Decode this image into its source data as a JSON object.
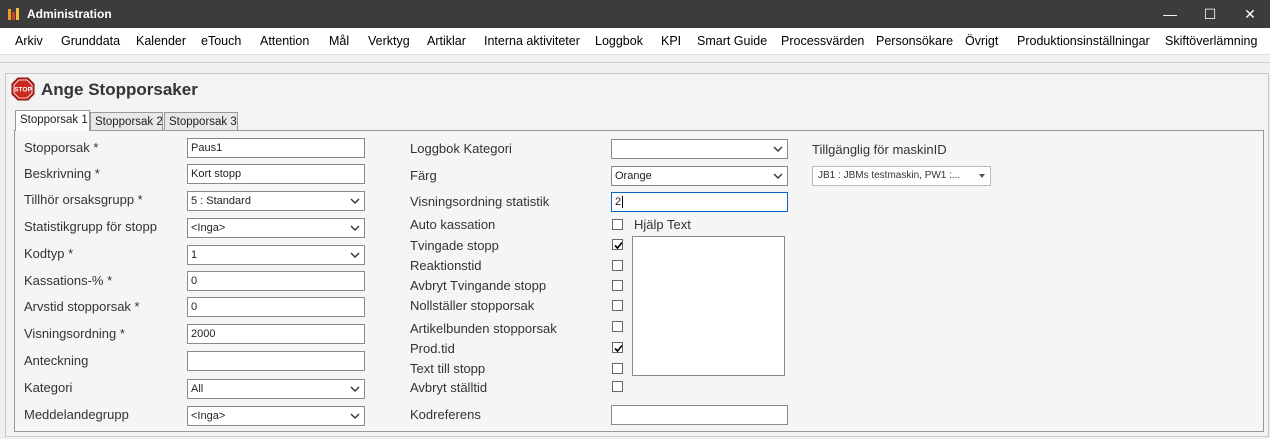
{
  "window": {
    "title": "Administration",
    "minimize": "—",
    "maximize": "☐",
    "close": "✕"
  },
  "menu": [
    "Arkiv",
    "Grunddata",
    "Kalender",
    "eTouch",
    "Attention",
    "Mål",
    "Verktyg",
    "Artiklar",
    "Interna aktiviteter",
    "Loggbok",
    "KPI",
    "Smart Guide",
    "Processvärden",
    "Personsökare",
    "Övrigt",
    "Produktionsinställningar",
    "Skiftöverlämning"
  ],
  "page": {
    "title": "Ange Stopporsaker",
    "stop_icon_text": "STOP"
  },
  "tabs": [
    "Stopporsak 1",
    "Stopporsak 2",
    "Stopporsak 3"
  ],
  "left": {
    "stopporsak": {
      "label": "Stopporsak *",
      "value": "Paus1"
    },
    "beskrivning": {
      "label": "Beskrivning *",
      "value": "Kort stopp"
    },
    "orsaksgrupp": {
      "label": "Tillhör orsaksgrupp *",
      "value": "5 : Standard"
    },
    "statistikgrupp": {
      "label": "Statistikgrupp för stopp",
      "value": "<Inga>"
    },
    "kodtyp": {
      "label": "Kodtyp *",
      "value": "1"
    },
    "kassation": {
      "label": "Kassations-% *",
      "value": "0"
    },
    "arvstid": {
      "label": "Arvstid stopporsak *",
      "value": "0"
    },
    "visningsordning": {
      "label": "Visningsordning *",
      "value": "2000"
    },
    "anteckning": {
      "label": "Anteckning",
      "value": ""
    },
    "kategori": {
      "label": "Kategori",
      "value": "All"
    },
    "meddelandegrupp": {
      "label": "Meddelandegrupp",
      "value": "<Inga>"
    }
  },
  "middle": {
    "loggbok_kategori": {
      "label": "Loggbok Kategori",
      "value": ""
    },
    "farg": {
      "label": "Färg",
      "value": "Orange"
    },
    "visning_statistik": {
      "label": "Visningsordning statistik",
      "value": "2"
    },
    "checks": [
      {
        "label": "Auto kassation",
        "checked": false
      },
      {
        "label": "Tvingade stopp",
        "checked": true
      },
      {
        "label": "Reaktionstid",
        "checked": false
      },
      {
        "label": "Avbryt Tvingande stopp",
        "checked": false
      },
      {
        "label": "Nollställer stopporsak",
        "checked": false
      },
      {
        "label": "Artikelbunden stopporsak",
        "checked": false
      },
      {
        "label": "Prod.tid",
        "checked": true
      },
      {
        "label": "Text till stopp",
        "checked": false
      },
      {
        "label": "Avbryt ställtid",
        "checked": false
      }
    ],
    "kodreferens": {
      "label": "Kodreferens",
      "value": ""
    },
    "hjalp_text_label": "Hjälp Text"
  },
  "right": {
    "maskin_label": "Tillgänglig för maskinID",
    "maskin_value": "JB1 : JBMs testmaskin, PW1 :..."
  }
}
